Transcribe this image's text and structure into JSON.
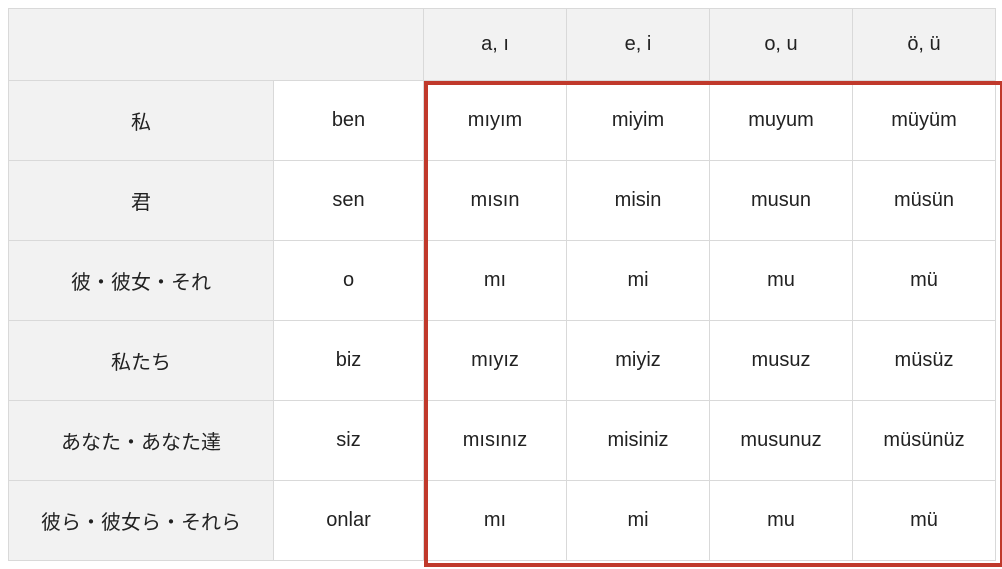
{
  "headers": {
    "blank": "",
    "col_a": "a, ı",
    "col_e": "e, i",
    "col_o": "o, u",
    "col_ou": "ö, ü"
  },
  "rows": [
    {
      "jp": "私",
      "pronoun": "ben",
      "a": "mıyım",
      "e": "miyim",
      "o": "muyum",
      "ou": "müyüm"
    },
    {
      "jp": "君",
      "pronoun": "sen",
      "a": "mısın",
      "e": "misin",
      "o": "musun",
      "ou": "müsün"
    },
    {
      "jp": "彼・彼女・それ",
      "pronoun": "o",
      "a": "mı",
      "e": "mi",
      "o": "mu",
      "ou": "mü"
    },
    {
      "jp": "私たち",
      "pronoun": "biz",
      "a": "mıyız",
      "e": "miyiz",
      "o": "musuz",
      "ou": "müsüz"
    },
    {
      "jp": "あなた・あなた達",
      "pronoun": "siz",
      "a": "mısınız",
      "e": "misiniz",
      "o": "musunuz",
      "ou": "müsünüz"
    },
    {
      "jp": "彼ら・彼女ら・それら",
      "pronoun": "onlar",
      "a": "mı",
      "e": "mi",
      "o": "mu",
      "ou": "mü"
    }
  ]
}
